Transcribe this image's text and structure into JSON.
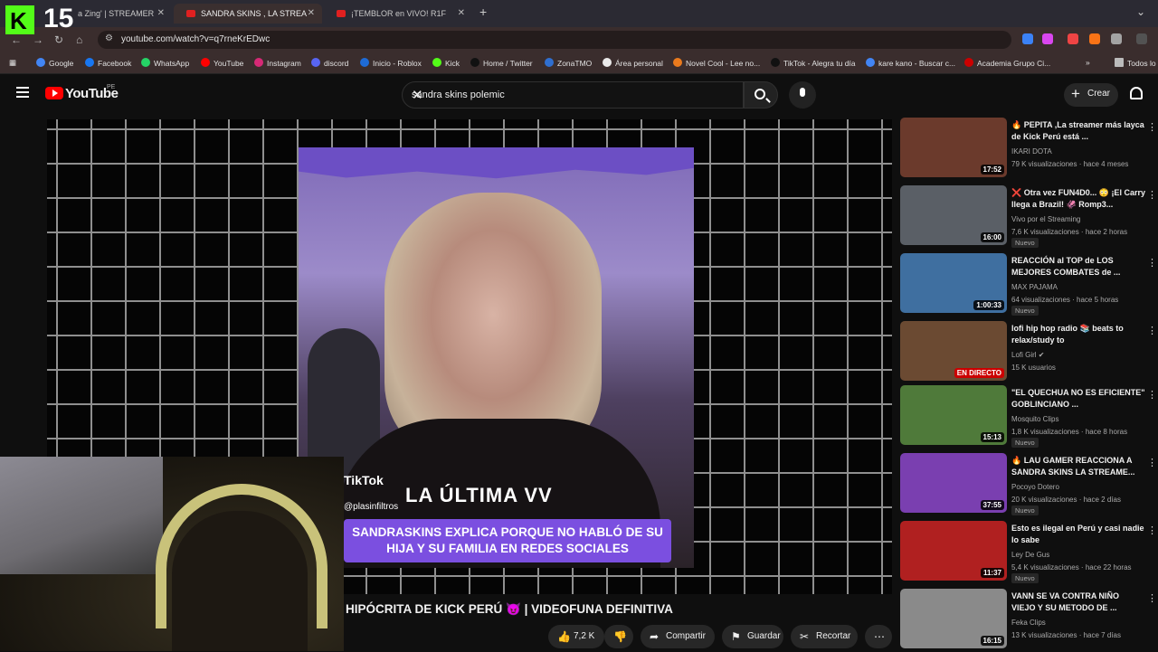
{
  "browser": {
    "tabs": [
      {
        "label": "a Zing' | STREAMER"
      },
      {
        "label": "SANDRA SKINS , LA STREA"
      },
      {
        "label": "¡TEMBLOR en VIVO! R1F"
      }
    ],
    "url": "youtube.com/watch?v=q7rneKrEDwc",
    "bookmarks": [
      "Google",
      "Facebook",
      "WhatsApp",
      "YouTube",
      "Instagram",
      "discord",
      "Inicio - Roblox",
      "Kick",
      "Home / Twitter",
      "ZonaTMO",
      "Área personal",
      "Novel Cool - Lee no...",
      "TikTok - Alegra tu día",
      "kare kano - Buscar c...",
      "Academia Grupo Ci...",
      "Todos lo"
    ]
  },
  "youtube": {
    "logo": "YouTube",
    "country": "PE",
    "search_query": "sandra skins polemic",
    "create_label": "Crear"
  },
  "overlay": {
    "kick_number": "15"
  },
  "video": {
    "tiktok_label": "TikTok",
    "tiktok_user": "@plasinfiltros",
    "caption_top": "LA ÚLTIMA VV",
    "caption": "SANDRASKINS EXPLICA PORQUE NO HABLÓ DE SU HIJA Y SU FAMILIA EN REDES SOCIALES",
    "title": "HIPÓCRITA DE KICK PERÚ 😈 | VIDEOFUNA DEFINITIVA",
    "likes": "7,2 K",
    "share": "Compartir",
    "save": "Guardar",
    "clip": "Recortar"
  },
  "related": [
    {
      "title": "🔥 PEPITA ,La streamer más layca de Kick Perú está ...",
      "channel": "IKARI DOTA",
      "meta": "79 K visualizaciones · hace 4 meses",
      "duration": "17:52",
      "badge": "",
      "color": "#6b3a2c"
    },
    {
      "title": "❌ Otra vez FUN4D0... 😳 ¡El Carry llega a Brazil! 🦑 Romp3...",
      "channel": "Vivo por el Streaming",
      "meta": "7,6 K visualizaciones · hace 2 horas",
      "duration": "16:00",
      "badge": "Nuevo",
      "color": "#5a5f66"
    },
    {
      "title": "REACCIÓN al TOP de LOS MEJORES COMBATES de ...",
      "channel": "MAX PAJAMA",
      "meta": "64 visualizaciones · hace 5 horas",
      "duration": "1:00:33",
      "badge": "Nuevo",
      "color": "#3f6fa0"
    },
    {
      "title": "lofi hip hop radio 📚 beats to relax/study to",
      "channel": "Lofi Girl ✔",
      "meta": "15 K usuarios",
      "duration": "EN DIRECTO",
      "badge": "",
      "color": "#6b4a32"
    },
    {
      "title": "\"EL QUECHUA NO ES EFICIENTE\" GOBLINCIANO ...",
      "channel": "Mosquito Clips",
      "meta": "1,8 K visualizaciones · hace 8 horas",
      "duration": "15:13",
      "badge": "Nuevo",
      "color": "#4f7a3a"
    },
    {
      "title": "🔥 LAU GAMER REACCIONA A SANDRA SKINS LA STREAME...",
      "channel": "Pocoyo Dotero",
      "meta": "20 K visualizaciones · hace 2 días",
      "duration": "37:55",
      "badge": "Nuevo",
      "color": "#7a3fb0"
    },
    {
      "title": "Esto es ilegal en Perú y casi nadie lo sabe",
      "channel": "Ley De Gus",
      "meta": "5,4 K visualizaciones · hace 22 horas",
      "duration": "11:37",
      "badge": "Nuevo",
      "color": "#b02020"
    },
    {
      "title": "VANN SE VA CONTRA NIÑO VIEJO Y SU METODO DE ...",
      "channel": "Feka Clips",
      "meta": "13 K visualizaciones · hace 7 días",
      "duration": "16:15",
      "badge": "",
      "color": "#8a8a8a"
    }
  ]
}
